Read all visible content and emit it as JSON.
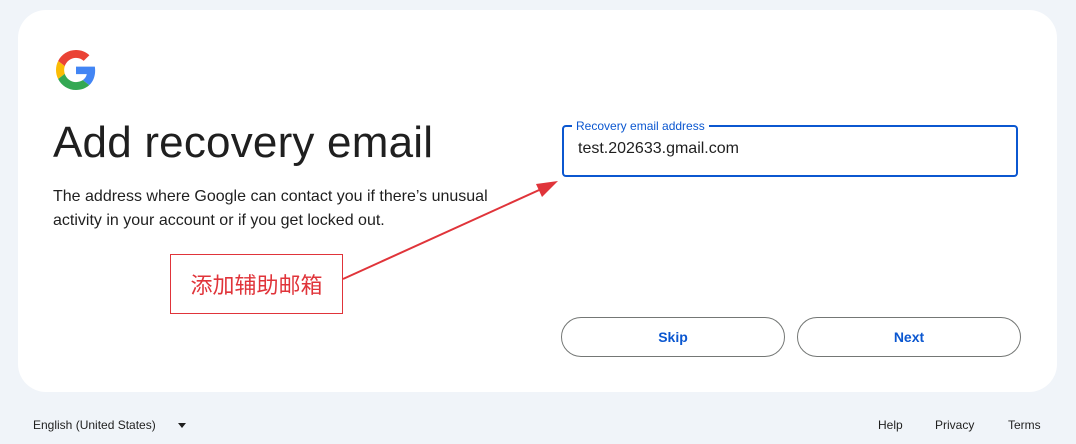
{
  "page": {
    "title": "Add recovery email",
    "description": "The address where Google can contact you if there’s unusual activity in your account or if you get locked out."
  },
  "logo": {
    "icon": "google-g-icon",
    "colors": [
      "#4285f4",
      "#ea4335",
      "#fbbc05",
      "#34a853"
    ]
  },
  "recovery_field": {
    "label": "Recovery email address",
    "value": "test.202633.gmail.com",
    "focus_color": "#0b57d0"
  },
  "buttons": {
    "skip": "Skip",
    "next": "Next"
  },
  "annotation": {
    "text": "添加辅助邮箱",
    "color": "#e0343a"
  },
  "footer": {
    "language": "English (United States)",
    "links": {
      "help": "Help",
      "privacy": "Privacy",
      "terms": "Terms"
    }
  }
}
